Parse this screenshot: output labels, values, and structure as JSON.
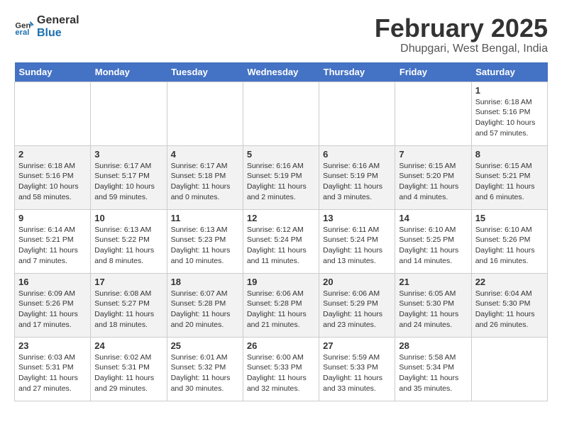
{
  "logo": {
    "line1": "General",
    "line2": "Blue"
  },
  "title": "February 2025",
  "subtitle": "Dhupgari, West Bengal, India",
  "days_of_week": [
    "Sunday",
    "Monday",
    "Tuesday",
    "Wednesday",
    "Thursday",
    "Friday",
    "Saturday"
  ],
  "weeks": [
    [
      {
        "day": "",
        "info": ""
      },
      {
        "day": "",
        "info": ""
      },
      {
        "day": "",
        "info": ""
      },
      {
        "day": "",
        "info": ""
      },
      {
        "day": "",
        "info": ""
      },
      {
        "day": "",
        "info": ""
      },
      {
        "day": "1",
        "info": "Sunrise: 6:18 AM\nSunset: 5:16 PM\nDaylight: 10 hours\nand 57 minutes."
      }
    ],
    [
      {
        "day": "2",
        "info": "Sunrise: 6:18 AM\nSunset: 5:16 PM\nDaylight: 10 hours\nand 58 minutes."
      },
      {
        "day": "3",
        "info": "Sunrise: 6:17 AM\nSunset: 5:17 PM\nDaylight: 10 hours\nand 59 minutes."
      },
      {
        "day": "4",
        "info": "Sunrise: 6:17 AM\nSunset: 5:18 PM\nDaylight: 11 hours\nand 0 minutes."
      },
      {
        "day": "5",
        "info": "Sunrise: 6:16 AM\nSunset: 5:19 PM\nDaylight: 11 hours\nand 2 minutes."
      },
      {
        "day": "6",
        "info": "Sunrise: 6:16 AM\nSunset: 5:19 PM\nDaylight: 11 hours\nand 3 minutes."
      },
      {
        "day": "7",
        "info": "Sunrise: 6:15 AM\nSunset: 5:20 PM\nDaylight: 11 hours\nand 4 minutes."
      },
      {
        "day": "8",
        "info": "Sunrise: 6:15 AM\nSunset: 5:21 PM\nDaylight: 11 hours\nand 6 minutes."
      }
    ],
    [
      {
        "day": "9",
        "info": "Sunrise: 6:14 AM\nSunset: 5:21 PM\nDaylight: 11 hours\nand 7 minutes."
      },
      {
        "day": "10",
        "info": "Sunrise: 6:13 AM\nSunset: 5:22 PM\nDaylight: 11 hours\nand 8 minutes."
      },
      {
        "day": "11",
        "info": "Sunrise: 6:13 AM\nSunset: 5:23 PM\nDaylight: 11 hours\nand 10 minutes."
      },
      {
        "day": "12",
        "info": "Sunrise: 6:12 AM\nSunset: 5:24 PM\nDaylight: 11 hours\nand 11 minutes."
      },
      {
        "day": "13",
        "info": "Sunrise: 6:11 AM\nSunset: 5:24 PM\nDaylight: 11 hours\nand 13 minutes."
      },
      {
        "day": "14",
        "info": "Sunrise: 6:10 AM\nSunset: 5:25 PM\nDaylight: 11 hours\nand 14 minutes."
      },
      {
        "day": "15",
        "info": "Sunrise: 6:10 AM\nSunset: 5:26 PM\nDaylight: 11 hours\nand 16 minutes."
      }
    ],
    [
      {
        "day": "16",
        "info": "Sunrise: 6:09 AM\nSunset: 5:26 PM\nDaylight: 11 hours\nand 17 minutes."
      },
      {
        "day": "17",
        "info": "Sunrise: 6:08 AM\nSunset: 5:27 PM\nDaylight: 11 hours\nand 18 minutes."
      },
      {
        "day": "18",
        "info": "Sunrise: 6:07 AM\nSunset: 5:28 PM\nDaylight: 11 hours\nand 20 minutes."
      },
      {
        "day": "19",
        "info": "Sunrise: 6:06 AM\nSunset: 5:28 PM\nDaylight: 11 hours\nand 21 minutes."
      },
      {
        "day": "20",
        "info": "Sunrise: 6:06 AM\nSunset: 5:29 PM\nDaylight: 11 hours\nand 23 minutes."
      },
      {
        "day": "21",
        "info": "Sunrise: 6:05 AM\nSunset: 5:30 PM\nDaylight: 11 hours\nand 24 minutes."
      },
      {
        "day": "22",
        "info": "Sunrise: 6:04 AM\nSunset: 5:30 PM\nDaylight: 11 hours\nand 26 minutes."
      }
    ],
    [
      {
        "day": "23",
        "info": "Sunrise: 6:03 AM\nSunset: 5:31 PM\nDaylight: 11 hours\nand 27 minutes."
      },
      {
        "day": "24",
        "info": "Sunrise: 6:02 AM\nSunset: 5:31 PM\nDaylight: 11 hours\nand 29 minutes."
      },
      {
        "day": "25",
        "info": "Sunrise: 6:01 AM\nSunset: 5:32 PM\nDaylight: 11 hours\nand 30 minutes."
      },
      {
        "day": "26",
        "info": "Sunrise: 6:00 AM\nSunset: 5:33 PM\nDaylight: 11 hours\nand 32 minutes."
      },
      {
        "day": "27",
        "info": "Sunrise: 5:59 AM\nSunset: 5:33 PM\nDaylight: 11 hours\nand 33 minutes."
      },
      {
        "day": "28",
        "info": "Sunrise: 5:58 AM\nSunset: 5:34 PM\nDaylight: 11 hours\nand 35 minutes."
      },
      {
        "day": "",
        "info": ""
      }
    ]
  ]
}
